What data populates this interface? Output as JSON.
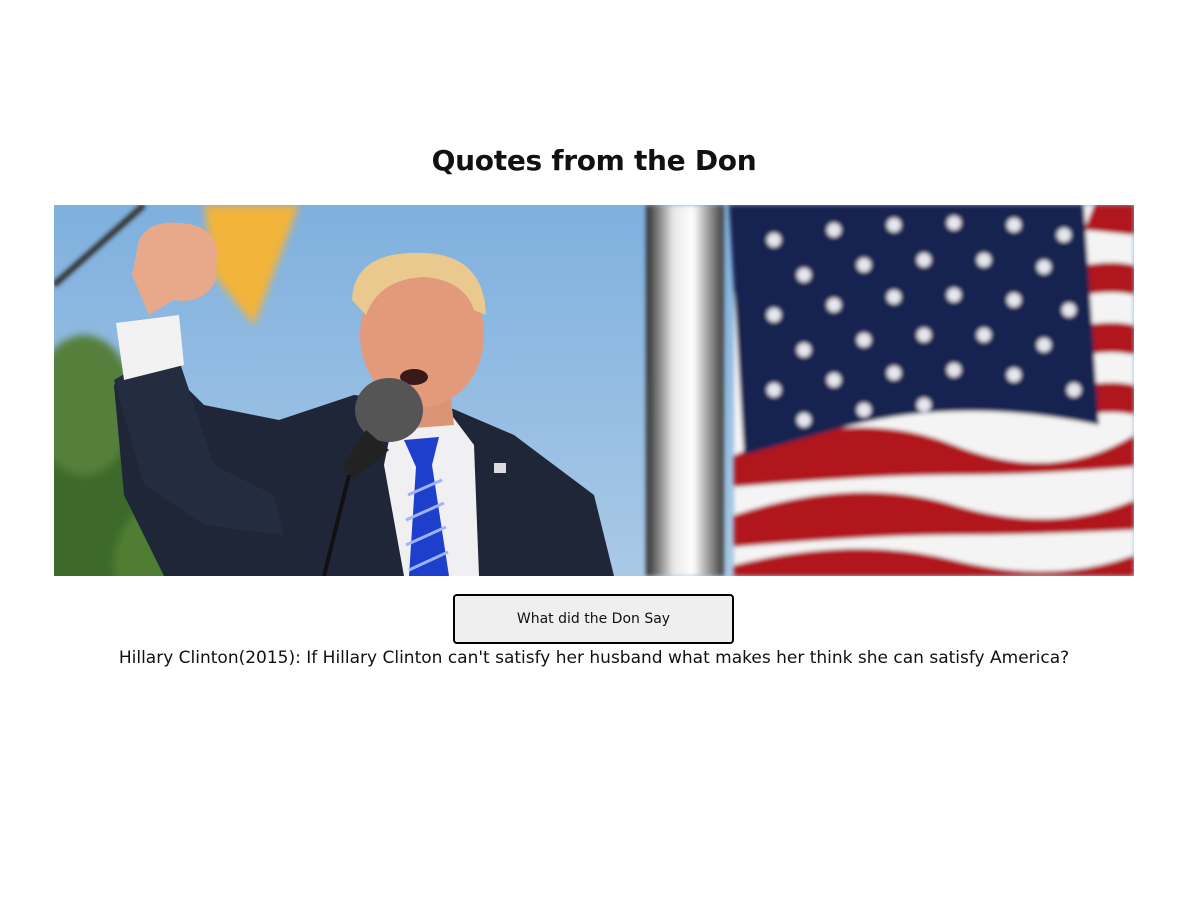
{
  "page": {
    "title": "Quotes from the Don"
  },
  "hero_image": {
    "icon": "photo-of-speaker-with-flag",
    "colors": {
      "sky": "#8db6dc",
      "suit": "#1f2638",
      "tie": "#1d3fcc",
      "flag_blue": "#17234f",
      "flag_red": "#b0121b",
      "foliage": "#3d6b2a"
    }
  },
  "button": {
    "label": "What did the Don Say",
    "color": "#efefef"
  },
  "quote": {
    "text": "Hillary Clinton(2015): If Hillary Clinton can't satisfy her husband what makes her think she can satisfy America?"
  }
}
